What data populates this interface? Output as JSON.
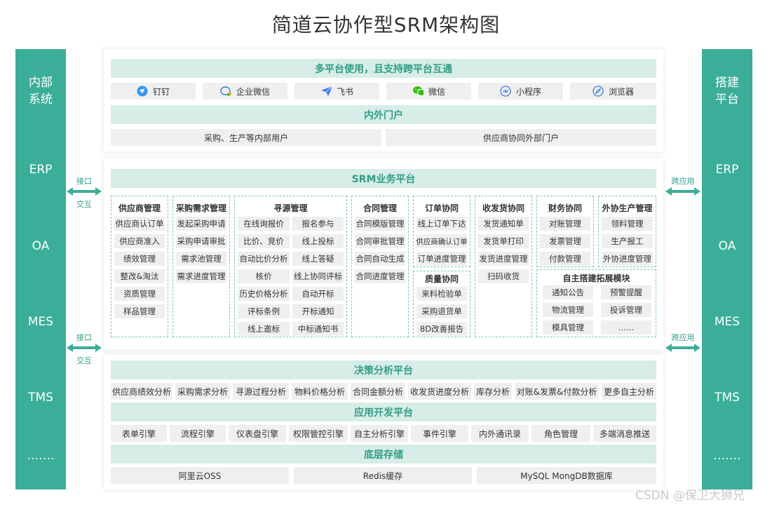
{
  "title": "简道云协作型SRM架构图",
  "left_column": {
    "title_line1": "内部",
    "title_line2": "系统",
    "items": [
      "ERP",
      "OA",
      "MES",
      "TMS",
      "……."
    ]
  },
  "right_column": {
    "title_line1": "搭建",
    "title_line2": "平台",
    "items": [
      "ERP",
      "OA",
      "MES",
      "TMS",
      "……."
    ]
  },
  "connectors": {
    "left_top": {
      "label1": "接口",
      "label2": "交互"
    },
    "left_bottom": {
      "label1": "接口",
      "label2": "交互"
    },
    "right_top": {
      "label1": "跨应用"
    },
    "right_bottom": {
      "label1": "跨应用"
    }
  },
  "top_section": {
    "platform_header": "多平台使用，且支持跨平台互通",
    "platforms": [
      {
        "label": "钉钉",
        "icon": "dingtalk-icon",
        "color": "#3296fa"
      },
      {
        "label": "企业微信",
        "icon": "wecom-icon",
        "color": "#2b7ee3"
      },
      {
        "label": "飞书",
        "icon": "feishu-icon",
        "color": "#3370ff"
      },
      {
        "label": "微信",
        "icon": "wechat-icon",
        "color": "#2dc100"
      },
      {
        "label": "小程序",
        "icon": "miniprogram-icon",
        "color": "#3a7ee0"
      },
      {
        "label": "浏览器",
        "icon": "browser-icon",
        "color": "#3a7ee0"
      }
    ],
    "portal_header": "内外门户",
    "portals": [
      "采购、生产等内部用户",
      "供应商协同外部门户"
    ]
  },
  "srm": {
    "header": "SRM业务平台",
    "modules": {
      "supplier": {
        "title": "供应商管理",
        "items": [
          "供应商认订单",
          "供应商准入",
          "绩效管理",
          "整改&淘汰",
          "资质管理",
          "样品管理"
        ]
      },
      "demand": {
        "title": "采购需求管理",
        "items": [
          "发起采购申请",
          "采购申请审批",
          "需求池管理",
          "需求进度管理"
        ]
      },
      "sourcing": {
        "title": "寻源管理",
        "items": [
          "在线询报价",
          "报名参与",
          "比价、竞价",
          "线上投标",
          "自动比价分析",
          "线上答疑",
          "核价",
          "线上协同评标",
          "历史价格分析",
          "自动开标",
          "评标条例",
          "开标通知",
          "线上邀标",
          "中标通知书"
        ]
      },
      "contract": {
        "title": "合同管理",
        "items": [
          "合同模版管理",
          "合同审批管理",
          "合同自动生成",
          "合同进度管理"
        ]
      },
      "order": {
        "title": "订单协同",
        "items": [
          "线上订单下达",
          "供应商确认订单",
          "订单进度管理"
        ]
      },
      "quality": {
        "title": "质量协同",
        "items": [
          "来料检验单",
          "采购退货单",
          "8D改善报告"
        ]
      },
      "delivery": {
        "title": "收发货协同",
        "items": [
          "发货通知单",
          "发货单打印",
          "发货进度管理",
          "扫码收货"
        ]
      },
      "finance": {
        "title": "财务协同",
        "items": [
          "对账管理",
          "发票管理",
          "付款管理"
        ]
      },
      "outsource": {
        "title": "外协生产管理",
        "items": [
          "领料管理",
          "生产报工",
          "外协进度管理"
        ]
      },
      "custom": {
        "title": "自主搭建拓展模块",
        "items": [
          "通知公告",
          "预警提醒",
          "物流管理",
          "投诉管理",
          "模具管理",
          "......"
        ]
      }
    }
  },
  "bottom_section": {
    "decision_header": "决策分析平台",
    "decision_items": [
      "供应商绩效分析",
      "采购需求分析",
      "寻源过程分析",
      "物料价格分析",
      "合同金额分析",
      "收发货进度分析",
      "库存分析",
      "对账&发票&付款分析",
      "更多自主分析"
    ],
    "appdev_header": "应用开发平台",
    "appdev_items": [
      "表单引擎",
      "流程引擎",
      "仪表盘引擎",
      "权限管控引擎",
      "自主分析引擎",
      "事件引擎",
      "内外通讯录",
      "角色管理",
      "多端消息推送"
    ],
    "storage_header": "底层存储",
    "storage_items": [
      "阿里云OSS",
      "Redis缓存",
      "MySQL MongDB数据库"
    ]
  },
  "watermark": "CSDN @保卫大狮兄"
}
